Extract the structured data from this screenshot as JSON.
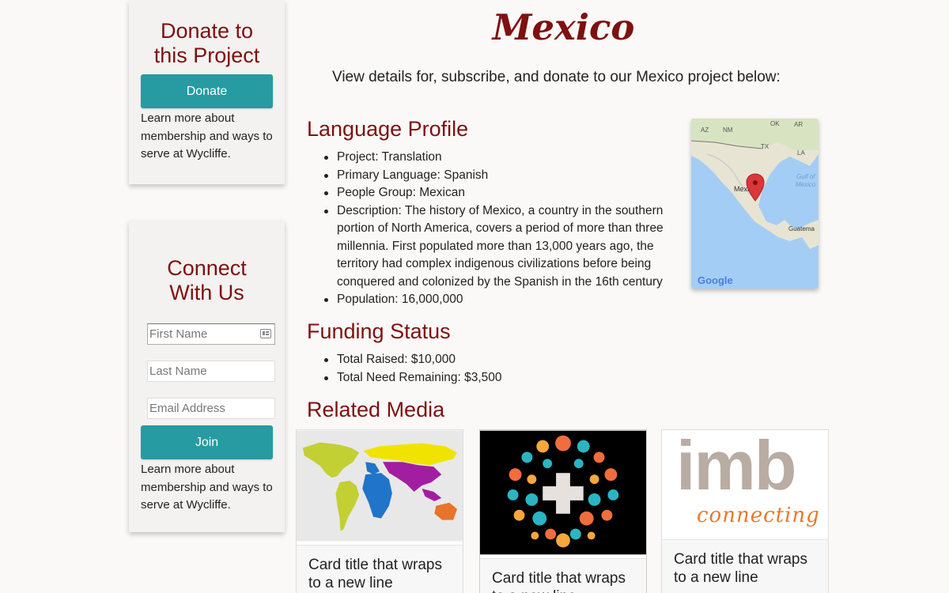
{
  "donate": {
    "heading": "Donate to this Project",
    "button": "Donate",
    "learn_more": "Learn more about membership and ways to serve at Wycliffe."
  },
  "connect": {
    "heading": "Connect With Us",
    "first_name_placeholder": "First Name",
    "last_name_placeholder": "Last Name",
    "email_placeholder": "Email Address",
    "join_button": "Join",
    "learn_more": "Learn more about membership and ways to serve at Wycliffe."
  },
  "page": {
    "title": "Mexico",
    "intro": "View details for, subscribe, and donate to our Mexico project below:"
  },
  "language_profile": {
    "heading": "Language Profile",
    "items": [
      "Project: Translation",
      "Primary Language: Spanish",
      "People Group: Mexican",
      "Description: The history of Mexico, a country in the southern portion of North America, covers a period of more than three millennia. First populated more than 13,000 years ago, the territory had complex indigenous civilizations before being conquered and colonized by the Spanish in the 16th century",
      "Population: 16,000,000"
    ]
  },
  "map": {
    "labels": [
      "AZ",
      "OK",
      "AR",
      "NM",
      "TX",
      "LA",
      "Gulf of",
      "Mexico",
      "Mexi",
      "Guatema"
    ],
    "logo": "Google"
  },
  "funding": {
    "heading": "Funding Status",
    "items": [
      "Total Raised: $10,000",
      "Total Need Remaining: $3,500"
    ]
  },
  "media": {
    "heading": "Related Media",
    "cards": [
      {
        "title": "Card title that wraps to a new line",
        "image": "world-map"
      },
      {
        "title": "Card title that wraps to a new line",
        "image": "dots-cross-logo"
      },
      {
        "title": "Card title that wraps to a new line",
        "image": "imb-connecting-logo",
        "logo_text": "imb",
        "logo_sub": "connecting"
      }
    ]
  },
  "colors": {
    "accent": "#7e1010",
    "button": "#269ba1",
    "background": "#faf9f7"
  }
}
